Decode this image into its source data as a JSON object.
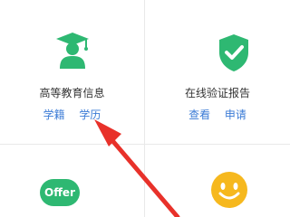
{
  "tiles": {
    "higher_education": {
      "title": "高等教育信息",
      "links": [
        "学籍",
        "学历"
      ],
      "icon": "graduation-cap-icon",
      "color": "#2eb872"
    },
    "online_report": {
      "title": "在线验证报告",
      "links": [
        "查看",
        "申请"
      ],
      "icon": "shield-check-icon",
      "color": "#2eb872"
    },
    "offer": {
      "badge_text": "Offer",
      "color": "#2eb872"
    },
    "smiley": {
      "icon": "smiley-icon",
      "color": "#f6b81e"
    }
  },
  "annotation": {
    "arrow_color": "#e8312a"
  }
}
